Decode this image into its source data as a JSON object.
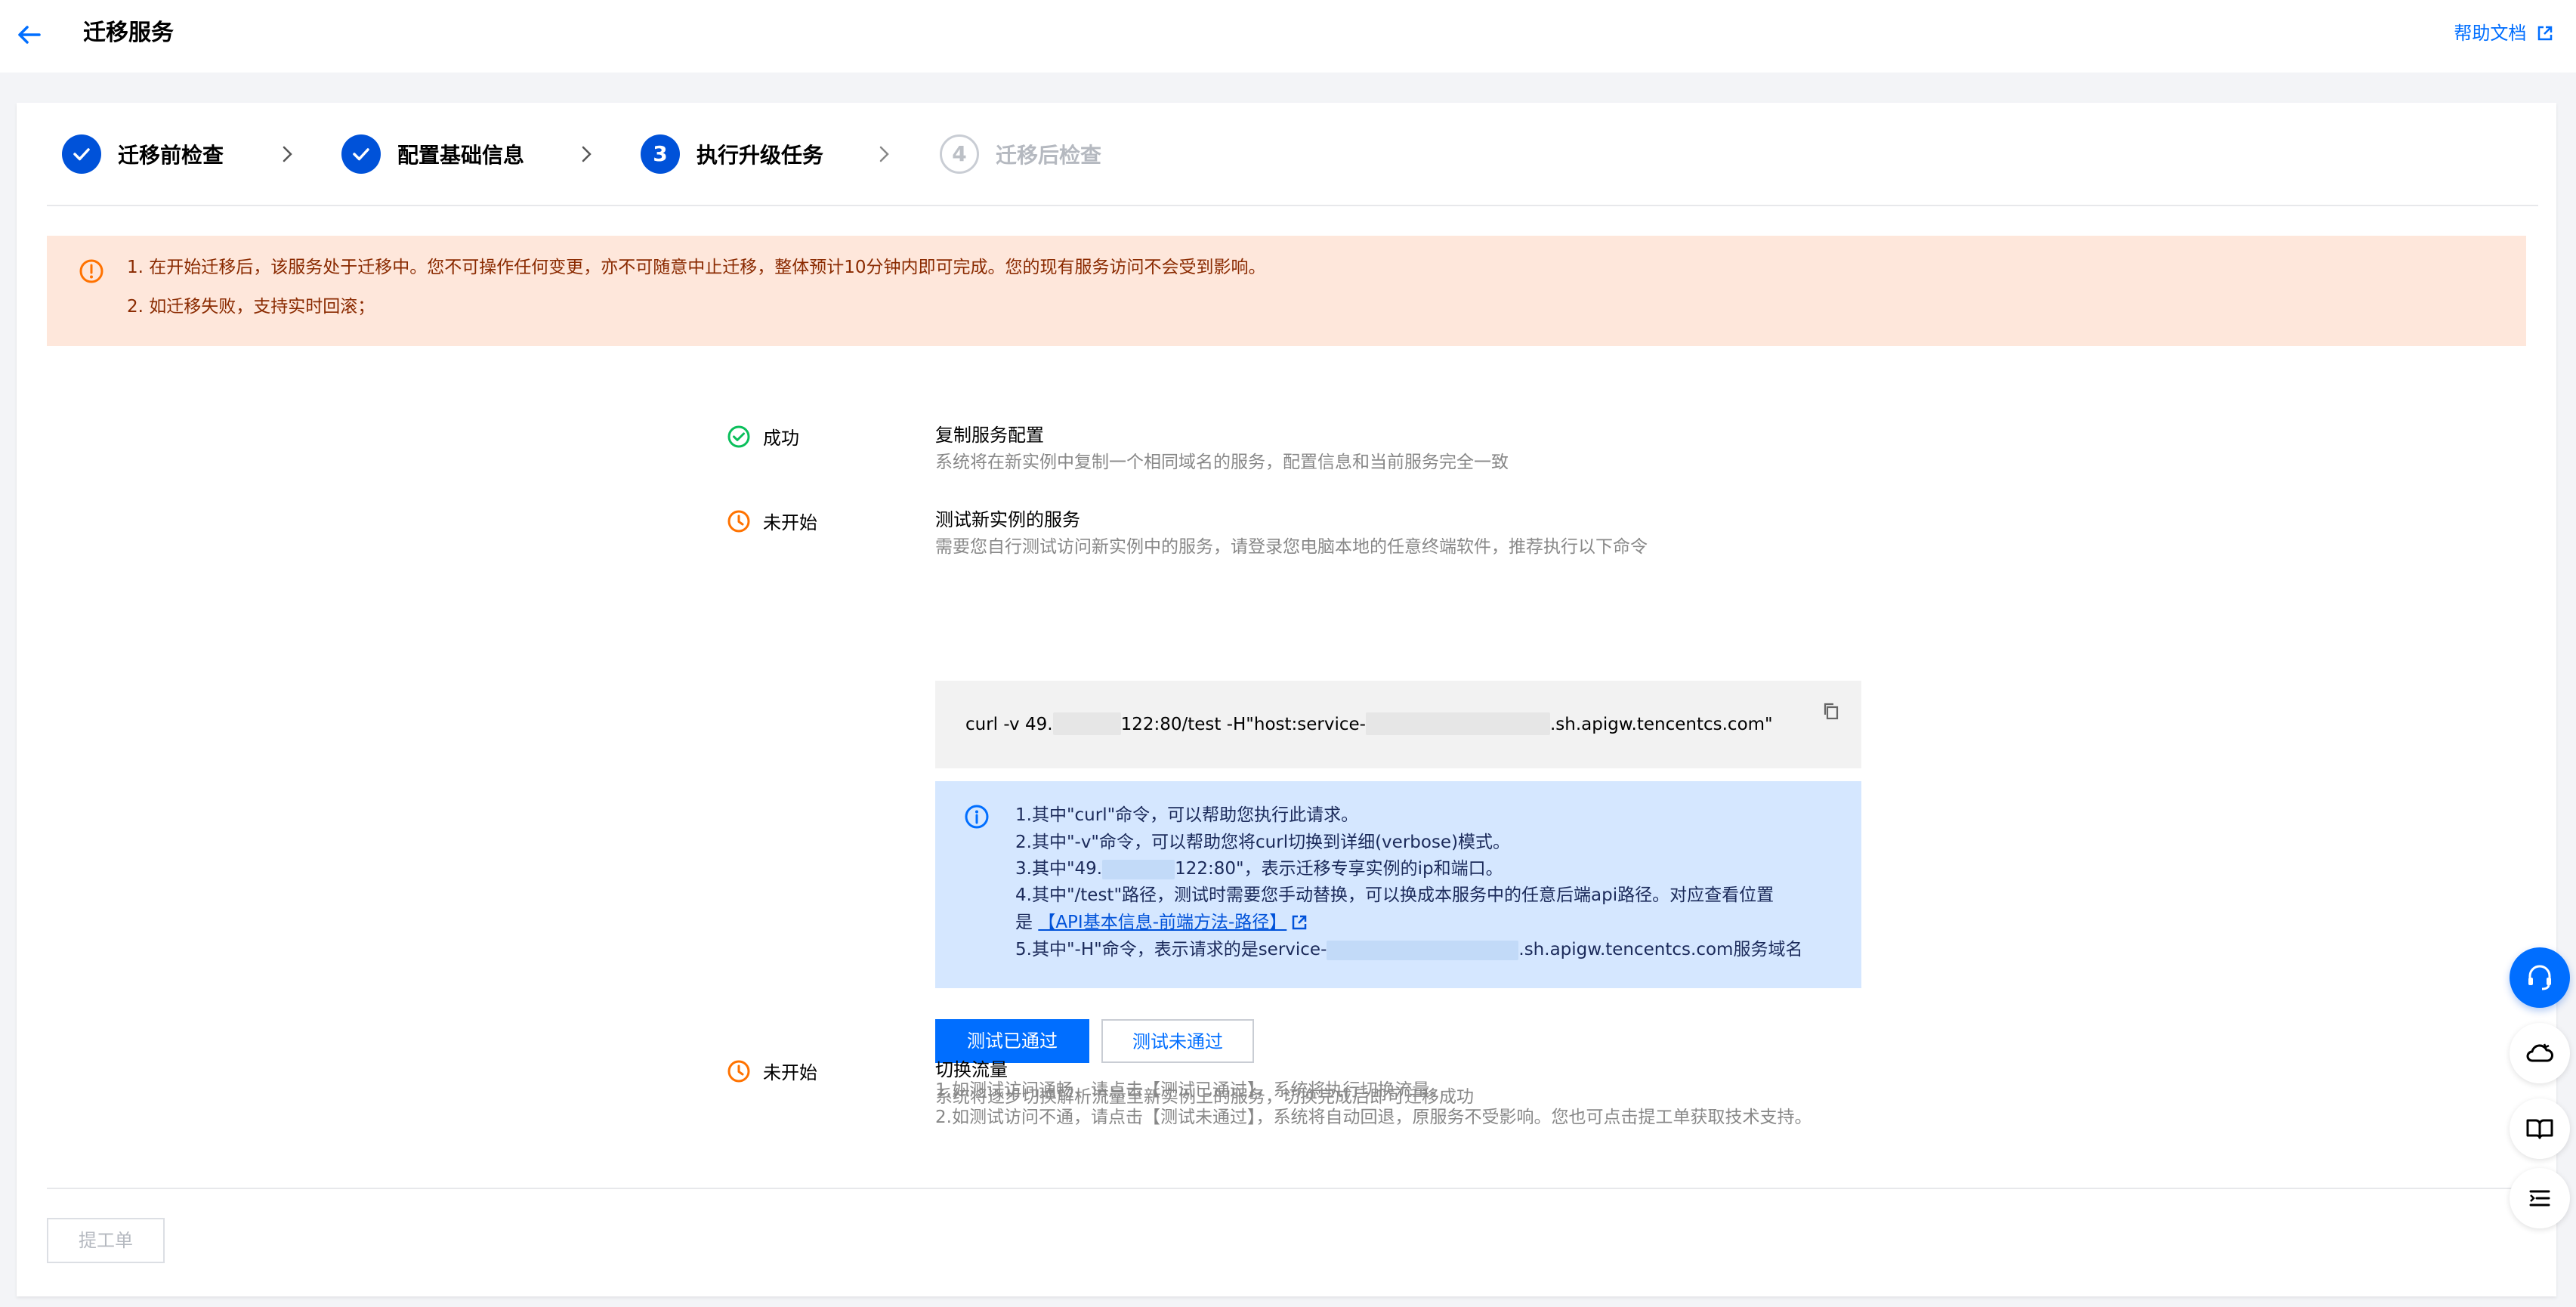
{
  "header": {
    "title": "迁移服务",
    "help_label": "帮助文档"
  },
  "steps": [
    {
      "label": "迁移前检查",
      "state": "done"
    },
    {
      "label": "配置基础信息",
      "state": "done"
    },
    {
      "label": "执行升级任务",
      "state": "active",
      "number": "3"
    },
    {
      "label": "迁移后检查",
      "state": "pending",
      "number": "4"
    }
  ],
  "alert": {
    "lines": [
      "1. 在开始迁移后，该服务处于迁移中。您不可操作任何变更，亦不可随意中止迁移，整体预计10分钟内即可完成。您的现有服务访问不会受到影响。",
      "2. 如迁移失败，支持实时回滚；"
    ]
  },
  "tasks": [
    {
      "status": "成功",
      "title": "复制服务配置",
      "desc": "系统将在新实例中复制一个相同域名的服务，配置信息和当前服务完全一致"
    },
    {
      "status": "未开始",
      "title": "测试新实例的服务",
      "desc": "需要您自行测试访问新实例中的服务，请登录您电脑本地的任意终端软件，推荐执行以下命令"
    },
    {
      "status": "未开始",
      "title": "切换流量",
      "desc": "系统将逐步切换解析流量至新实例上的服务，切换完成后即可迁移成功"
    }
  ],
  "command": {
    "part1": "curl -v 49.",
    "part2": "122:80/test -H\"host:service-",
    "part3": ".sh.apigw.tencentcs.com\""
  },
  "info": {
    "line1": "1.其中\"curl\"命令，可以帮助您执行此请求。",
    "line2": "2.其中\"-v\"命令，可以帮助您将curl切换到详细(verbose)模式。",
    "line3a": "3.其中\"49.",
    "line3b": "122:80\"，表示迁移专享实例的ip和端口。",
    "line4": "4.其中\"/test\"路径，测试时需要您手动替换，可以换成本服务中的任意后端api路径。对应查看位置",
    "line5_prefix": "是 ",
    "line5_link": "【API基本信息-前端方法-路径】",
    "line6a": "5.其中\"-H\"命令，表示请求的是service-",
    "line6b": ".sh.apigw.tencentcs.com服务域名"
  },
  "buttons": {
    "pass": "测试已通过",
    "fail": "测试未通过",
    "note1": "1.如测试访问通畅，请点击【测试已通过】，系统将执行切换流量。",
    "note2": "2.如测试访问不通，请点击【测试未通过】，系统将自动回退，原服务不受影响。您也可点击提工单获取技术支持。"
  },
  "footer": {
    "ticket_label": "提工单"
  },
  "colors": {
    "primary": "#006eff",
    "success": "#0abf5b",
    "warning": "#ff7200",
    "alert_bg": "#fee7db",
    "info_bg": "#d5e7ff"
  }
}
